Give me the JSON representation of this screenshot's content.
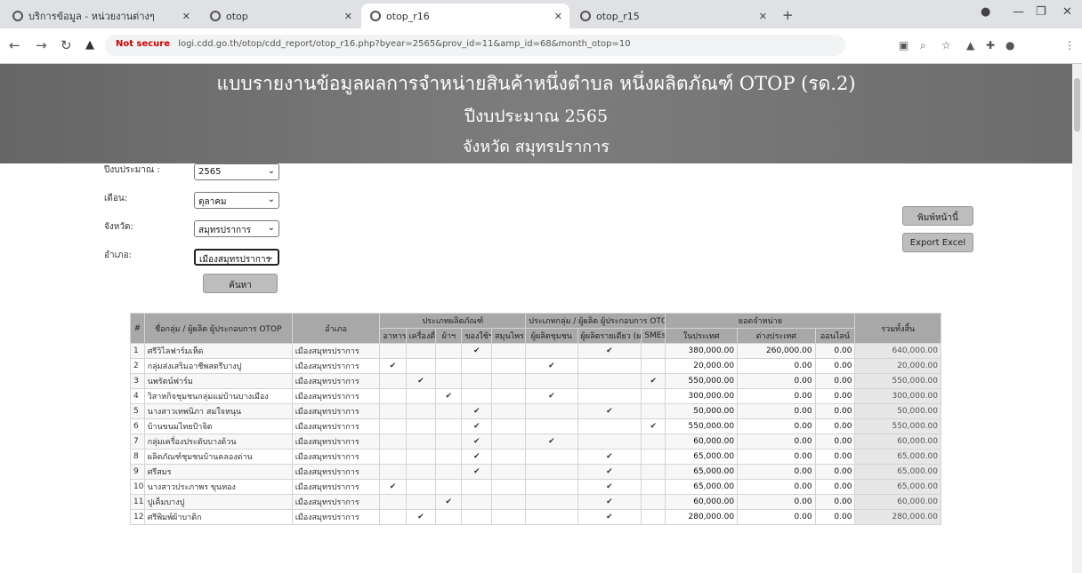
{
  "browser": {
    "tabs": [
      {
        "label": "บริการข้อมูล - หน่วยงานต่างๆ"
      },
      {
        "label": "otop"
      },
      {
        "label": "otop_r16"
      },
      {
        "label": "otop_r15"
      }
    ],
    "url_warning": "Not secure",
    "url": "logi.cdd.go.th/otop/cdd_report/otop_r16.php?byear=2565&prov_id=11&amp_id=68&month_otop=10"
  },
  "banner": {
    "line1": "แบบรายงานข้อมูลผลการจำหน่ายสินค้าหนึ่งตำบล หนึ่งผลิตภัณฑ์ OTOP (รด.2)",
    "line2": "ปีงบประมาณ 2565",
    "line3": "จังหวัด สมุทรปราการ"
  },
  "form": {
    "year_label": "ปีงบประมาณ :",
    "year_value": "2565",
    "month_label": "เดือน:",
    "month_value": "ตุลาคม",
    "province_label": "จังหวัด:",
    "province_value": "สมุทรปราการ",
    "district_label": "อำเภอ:",
    "district_value": "เมืองสมุทรปราการ",
    "search_button": "ค้นหา"
  },
  "side_buttons": {
    "print": "พิมพ์หน้านี้",
    "export": "Export Excel"
  },
  "table": {
    "headers": {
      "no": "#",
      "name": "ชื่อกลุ่ม / ผู้ผลิต ผู้ประกอบการ OTOP",
      "district": "อำเภอ",
      "group_type": "ประเภทผลิตภัณฑ์",
      "group_otop": "ประเภทกลุ่ม / ผู้ผลิต ผู้ประกอบการ OTOP",
      "group_sales": "ยอดจำหน่าย",
      "sub_types": [
        "อาหาร",
        "เครื่องดื่ม",
        "ผ้าฯ",
        "ของใช้ฯ",
        "สมุนไพร"
      ],
      "sub_otop": [
        "ผู้ผลิตชุมชน",
        "ผู้ผลิตรายเดียว (ผลิตโดยรายเดียว)",
        "SMEs"
      ],
      "sub_sales": [
        "ในประเทศ",
        "ต่างประเทศ",
        "ออนไลน์"
      ],
      "total": "รวมทั้งสิ้น"
    },
    "rows": [
      {
        "no": "1",
        "name": "ศรีวิไลฟาร์มเห็ด",
        "district": "เมืองสมุทรปราการ",
        "type_col": 3,
        "otop_col": 1,
        "domestic": "380,000.00",
        "foreign": "260,000.00",
        "online": "0.00",
        "total": "640,000.00"
      },
      {
        "no": "2",
        "name": "กลุ่มส่งเสริมอาชีพสตรีบางปู",
        "district": "เมืองสมุทรปราการ",
        "type_col": 0,
        "otop_col": 0,
        "domestic": "20,000.00",
        "foreign": "0.00",
        "online": "0.00",
        "total": "20,000.00"
      },
      {
        "no": "3",
        "name": "นพรัตน์ฟาร์ม",
        "district": "เมืองสมุทรปราการ",
        "type_col": 1,
        "otop_col": 2,
        "domestic": "550,000.00",
        "foreign": "0.00",
        "online": "0.00",
        "total": "550,000.00"
      },
      {
        "no": "4",
        "name": "วิสาหกิจชุมชนกลุ่มแม่บ้านบางเมือง",
        "district": "เมืองสมุทรปราการ",
        "type_col": 2,
        "otop_col": 0,
        "domestic": "300,000.00",
        "foreign": "0.00",
        "online": "0.00",
        "total": "300,000.00"
      },
      {
        "no": "5",
        "name": "นางสาวเทพนิภา สมใจหนุน",
        "district": "เมืองสมุทรปราการ",
        "type_col": 3,
        "otop_col": 1,
        "domestic": "50,000.00",
        "foreign": "0.00",
        "online": "0.00",
        "total": "50,000.00"
      },
      {
        "no": "6",
        "name": "บ้านขนมไทยป้าจิต",
        "district": "เมืองสมุทรปราการ",
        "type_col": 3,
        "otop_col": 2,
        "domestic": "550,000.00",
        "foreign": "0.00",
        "online": "0.00",
        "total": "550,000.00"
      },
      {
        "no": "7",
        "name": "กลุ่มเครื่องประดับบางด้วน",
        "district": "เมืองสมุทรปราการ",
        "type_col": 3,
        "otop_col": 0,
        "domestic": "60,000.00",
        "foreign": "0.00",
        "online": "0.00",
        "total": "60,000.00"
      },
      {
        "no": "8",
        "name": "ผลิตภัณฑ์ชุมชนบ้านคลองด่าน",
        "district": "เมืองสมุทรปราการ",
        "type_col": 3,
        "otop_col": 1,
        "domestic": "65,000.00",
        "foreign": "0.00",
        "online": "0.00",
        "total": "65,000.00"
      },
      {
        "no": "9",
        "name": "ศรีสมร",
        "district": "เมืองสมุทรปราการ",
        "type_col": 3,
        "otop_col": 1,
        "domestic": "65,000.00",
        "foreign": "0.00",
        "online": "0.00",
        "total": "65,000.00"
      },
      {
        "no": "10",
        "name": "นางสาวประภาพร ขุนทอง",
        "district": "เมืองสมุทรปราการ",
        "type_col": 0,
        "otop_col": 1,
        "domestic": "65,000.00",
        "foreign": "0.00",
        "online": "0.00",
        "total": "65,000.00"
      },
      {
        "no": "11",
        "name": "ปูเค็มบางปู",
        "district": "เมืองสมุทรปราการ",
        "type_col": 2,
        "otop_col": 1,
        "domestic": "60,000.00",
        "foreign": "0.00",
        "online": "0.00",
        "total": "60,000.00"
      },
      {
        "no": "12",
        "name": "ศรีพิมพ์ผ้าบาติก",
        "district": "เมืองสมุทรปราการ",
        "type_col": 1,
        "otop_col": 1,
        "domestic": "280,000.00",
        "foreign": "0.00",
        "online": "0.00",
        "total": "280,000.00"
      }
    ],
    "check_glyph": "✔"
  }
}
